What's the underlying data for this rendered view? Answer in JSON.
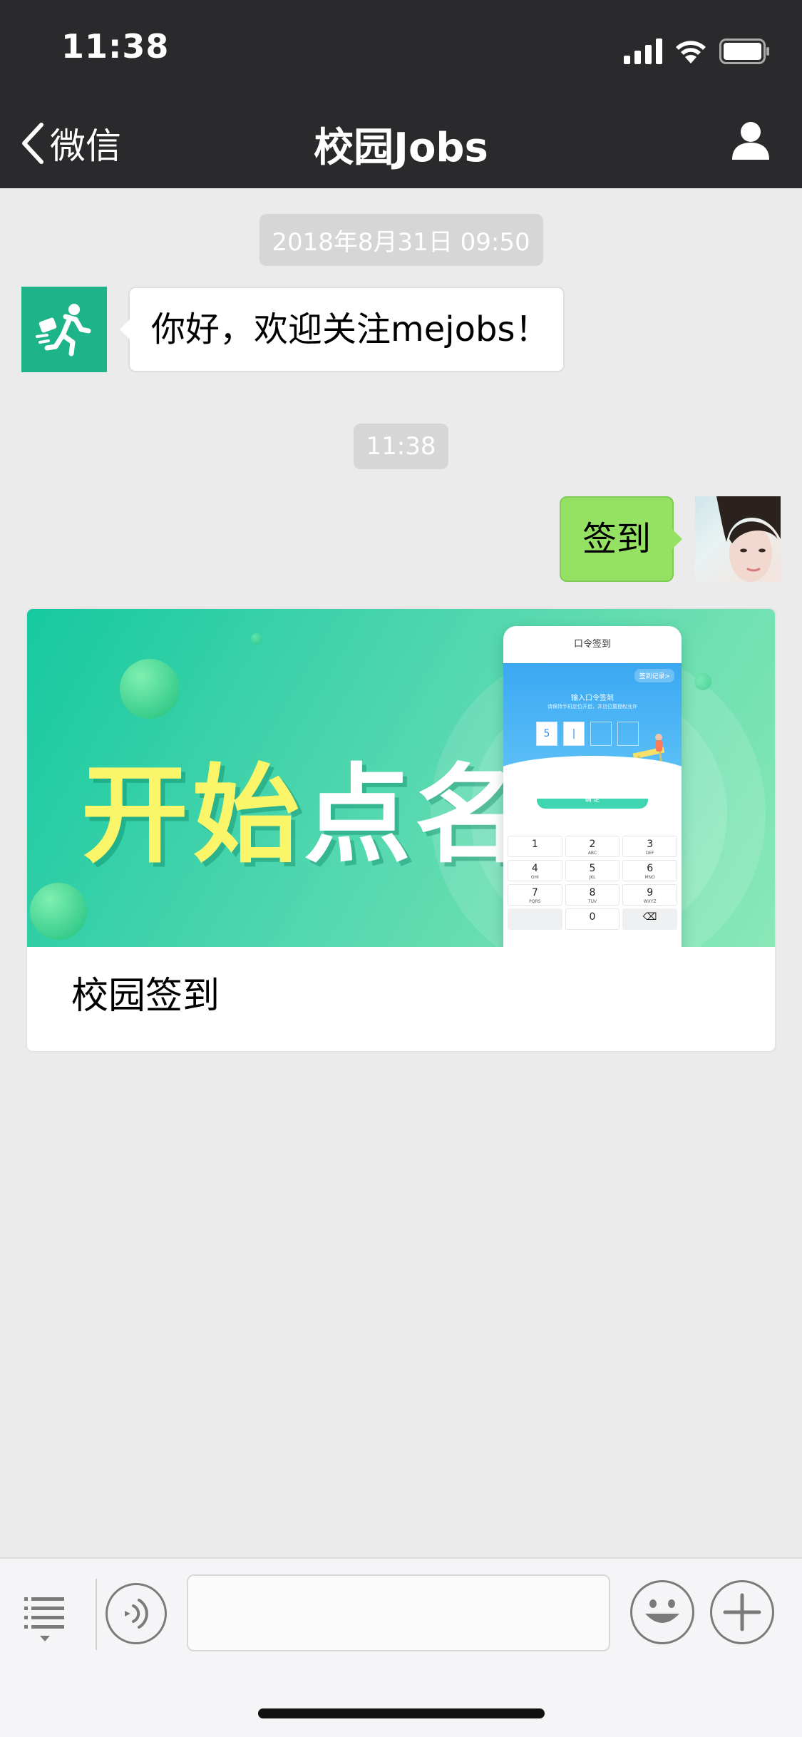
{
  "status_bar": {
    "time": "11:38",
    "icons": [
      "signal-icon",
      "wifi-icon",
      "battery-icon"
    ]
  },
  "nav": {
    "back_label": "微信",
    "title": "校园Jobs",
    "right_icon": "person-icon"
  },
  "messages": [
    {
      "type": "timestamp",
      "text": "2018年8月31日 09:50"
    },
    {
      "type": "incoming",
      "text": "你好，欢迎关注mejobs！"
    },
    {
      "type": "timestamp",
      "text": "11:38"
    },
    {
      "type": "outgoing",
      "text": "签到"
    }
  ],
  "card": {
    "title": "校园签到",
    "banner": {
      "headline_highlight": "开始",
      "headline_rest": "点名",
      "phone": {
        "header": "口令签到",
        "record_link": "签到记录>",
        "prompt": "输入口令签到",
        "hint": "请保持手机定位开启，并且位置授权允许",
        "codes": [
          "5",
          "|",
          "",
          ""
        ],
        "confirm": "确 定",
        "keys": [
          {
            "num": "1",
            "letters": ""
          },
          {
            "num": "2",
            "letters": "ABC"
          },
          {
            "num": "3",
            "letters": "DEF"
          },
          {
            "num": "4",
            "letters": "GHI"
          },
          {
            "num": "5",
            "letters": "JKL"
          },
          {
            "num": "6",
            "letters": "MNO"
          },
          {
            "num": "7",
            "letters": "PQRS"
          },
          {
            "num": "8",
            "letters": "TUV"
          },
          {
            "num": "9",
            "letters": "WXYZ"
          },
          {
            "num": "",
            "letters": ""
          },
          {
            "num": "0",
            "letters": ""
          },
          {
            "num": "⌫",
            "letters": ""
          }
        ]
      }
    }
  },
  "input_bar": {
    "placeholder": "",
    "icons": [
      "menu-list-icon",
      "voice-icon",
      "emoji-icon",
      "plus-icon"
    ]
  },
  "colors": {
    "nav_bg": "#2a2a2c",
    "chat_bg": "#ebebeb",
    "outgoing_bubble": "#95e163",
    "bot_avatar": "#1db48a",
    "banner_accent": "#fbf569"
  }
}
